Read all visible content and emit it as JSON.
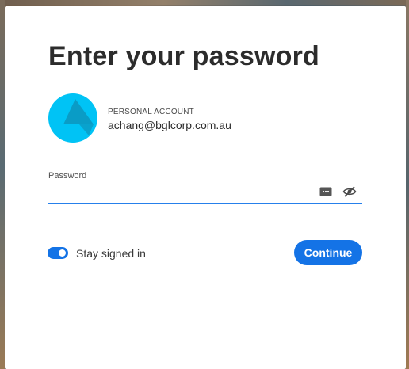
{
  "page": {
    "title": "Enter your password"
  },
  "account": {
    "type_label": "PERSONAL ACCOUNT",
    "email": "achang@bglcorp.com.au",
    "avatar_color": "#00c3f5"
  },
  "password": {
    "label": "Password",
    "value": "",
    "keychain_icon": "keychain-dots-icon",
    "visibility_icon": "eye-slash-icon"
  },
  "stay_signed_in": {
    "label": "Stay signed in",
    "checked": true
  },
  "actions": {
    "continue_label": "Continue"
  },
  "colors": {
    "accent": "#1473e6",
    "focus_underline": "#2680eb",
    "title_text": "#2c2c2c",
    "card_background": "#ffffff"
  }
}
